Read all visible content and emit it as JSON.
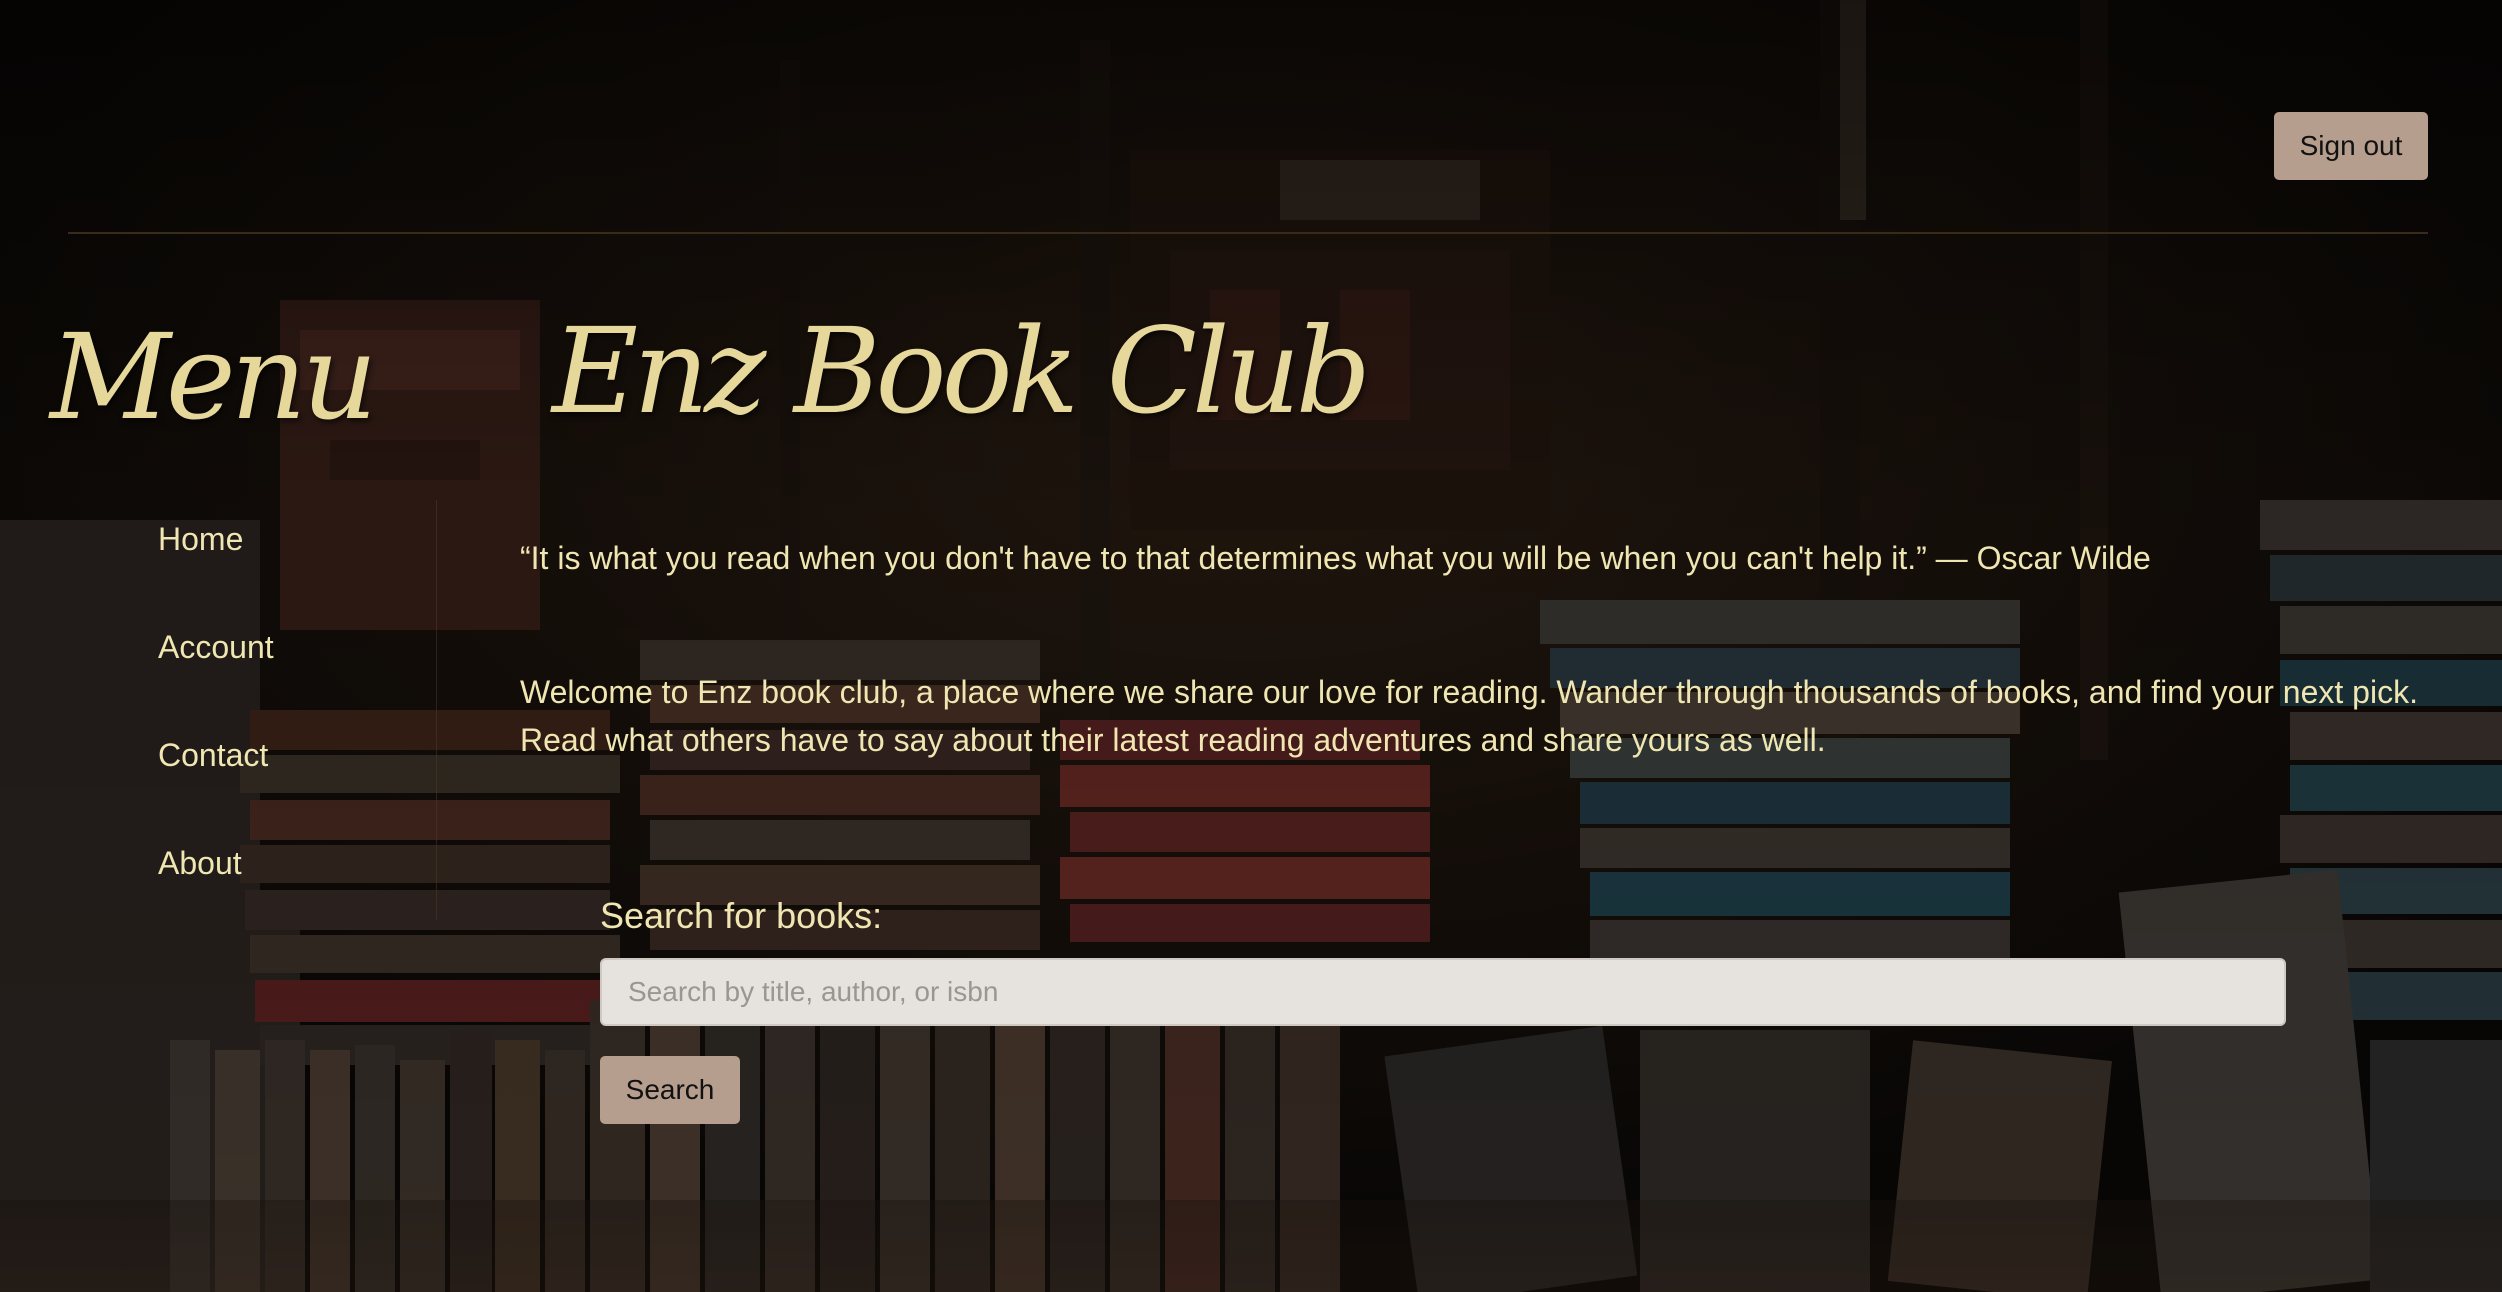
{
  "header": {
    "signout_label": "Sign out"
  },
  "sidebar": {
    "title": "Menu",
    "items": [
      {
        "label": "Home"
      },
      {
        "label": "Account"
      },
      {
        "label": "Contact"
      },
      {
        "label": "About"
      }
    ]
  },
  "main": {
    "title": "Enz Book Club",
    "quote": "“It is what you read when you don't have to that determines what you will be when you can't help it.” — Oscar Wilde",
    "welcome_line_1": "Welcome to Enz book club, a place where we share our love for reading. Wander through thousands of books, and find your next pick.",
    "welcome_line_2": "Read what others have to say about their latest reading adventures and share yours as well."
  },
  "search": {
    "label": "Search for books:",
    "placeholder": "Search by title, author, or isbn",
    "value": "",
    "button_label": "Search"
  },
  "colors": {
    "accent_text": "#e6d79a",
    "body_text": "#f0e6b2",
    "button_bg": "#b69e8e",
    "input_bg": "#e6e2de"
  }
}
